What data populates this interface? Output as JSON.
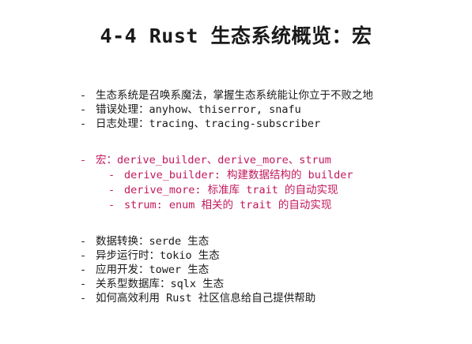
{
  "title": "4-4 Rust 生态系统概览：宏",
  "group1": [
    "生态系统是召唤系魔法，掌握生态系统能让你立于不败之地",
    "错误处理：anyhow、thiserror, snafu",
    "日志处理：tracing、tracing-subscriber"
  ],
  "group2": {
    "main": "宏：derive_builder、derive_more、strum",
    "sub": [
      "derive_builder: 构建数据结构的 builder",
      "derive_more: 标准库 trait 的自动实现",
      "strum: enum 相关的 trait 的自动实现"
    ]
  },
  "group3": [
    "数据转换：serde 生态",
    "异步运行时：tokio 生态",
    "应用开发：tower 生态",
    "关系型数据库：sqlx 生态",
    "如何高效利用 Rust 社区信息给自己提供帮助"
  ],
  "bullet_marker": "-",
  "colors": {
    "text": "#1a1a1a",
    "accent": "#c2185b",
    "background": "#ffffff"
  }
}
